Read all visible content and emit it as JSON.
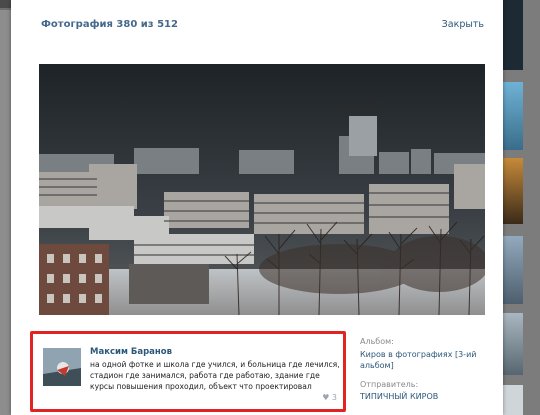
{
  "photo_viewer": {
    "title": "Фотография 380 из 512",
    "close_label": "Закрыть"
  },
  "comment": {
    "author": "Максим Баранов",
    "text": "на одной фотке и школа где учился, и больница где лечился, стадион где занимался, работа где работаю, здание где курсы повышения проходил, объект что проектировал",
    "likes": "3"
  },
  "info": {
    "album_label": "Альбом:",
    "album_value": "Киров в фотографиях [3-ий альбом]",
    "sender_label": "Отправитель:",
    "sender_value": "ТИПИЧНЫЙ КИРОВ"
  },
  "colors": {
    "highlight_border": "#e02424",
    "link": "#2b587a"
  }
}
